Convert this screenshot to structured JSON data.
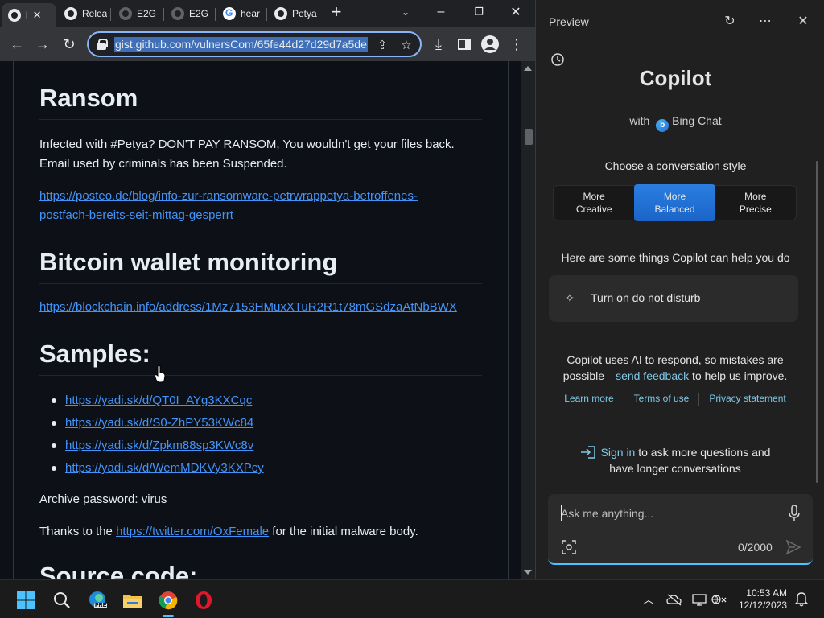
{
  "browser": {
    "tabs": [
      {
        "label": "l"
      },
      {
        "label": "Relea"
      },
      {
        "label": "E2G"
      },
      {
        "label": "E2G"
      },
      {
        "label": "hear"
      },
      {
        "label": "Petya"
      }
    ],
    "new_tab_icon": "plus-icon",
    "url": "gist.github.com/vulnersCom/65fe44d27d29d7a5de"
  },
  "page": {
    "sections": {
      "ransom": {
        "heading": "Ransom",
        "line1": "Infected with #Petya? DON'T PAY RANSOM, You wouldn't get your files back.",
        "line2": "Email used by criminals has been Suspended.",
        "link_line1": "https://posteo.de/blog/info-zur-ransomware-petrwrappetya-betroffenes-",
        "link_line2": "postfach-bereits-seit-mittag-gesperrt"
      },
      "bitcoin": {
        "heading": "Bitcoin wallet monitoring",
        "link": "https://blockchain.info/address/1Mz7153HMuxXTuR2R1t78mGSdzaAtNbBWX"
      },
      "samples": {
        "heading": "Samples:",
        "links": [
          "https://yadi.sk/d/QT0I_AYg3KXCqc",
          "https://yadi.sk/d/S0-ZhPY53KWc84",
          "https://yadi.sk/d/Zpkm88sp3KWc8v",
          "https://yadi.sk/d/WemMDKVy3KXPcy"
        ],
        "archive_password": "Archive password: virus",
        "thanks_prefix": "Thanks to the ",
        "thanks_link": "https://twitter.com/OxFemale",
        "thanks_suffix": " for the initial malware body."
      },
      "source": {
        "heading": "Source code:"
      }
    }
  },
  "copilot": {
    "title": "Preview",
    "heading": "Copilot",
    "with_prefix": "with",
    "with_brand": "Bing Chat",
    "choose_style": "Choose a conversation style",
    "styles": [
      {
        "line1": "More",
        "line2": "Creative",
        "selected": false
      },
      {
        "line1": "More",
        "line2": "Balanced",
        "selected": true
      },
      {
        "line1": "More",
        "line2": "Precise",
        "selected": false
      }
    ],
    "help_heading": "Here are some things Copilot can help you do",
    "suggestion": "Turn on do not disturb",
    "ai_notice_1": "Copilot uses AI to respond, so mistakes are",
    "ai_notice_2a": "possible—",
    "ai_notice_link": "send feedback",
    "ai_notice_2b": " to help us improve.",
    "links": [
      "Learn more",
      "Terms of use",
      "Privacy statement"
    ],
    "sign_in_link": "Sign in",
    "sign_in_rest_1": " to ask more questions and",
    "sign_in_rest_2": "have longer conversations",
    "input_placeholder": "Ask me anything...",
    "char_count": "0/2000"
  },
  "taskbar": {
    "time": "10:53 AM",
    "date": "12/12/2023",
    "edge_badge": "PRE"
  },
  "colors": {
    "link": "#4493f8",
    "accent": "#4cc2ff",
    "selected_style": "#1b64c8"
  }
}
